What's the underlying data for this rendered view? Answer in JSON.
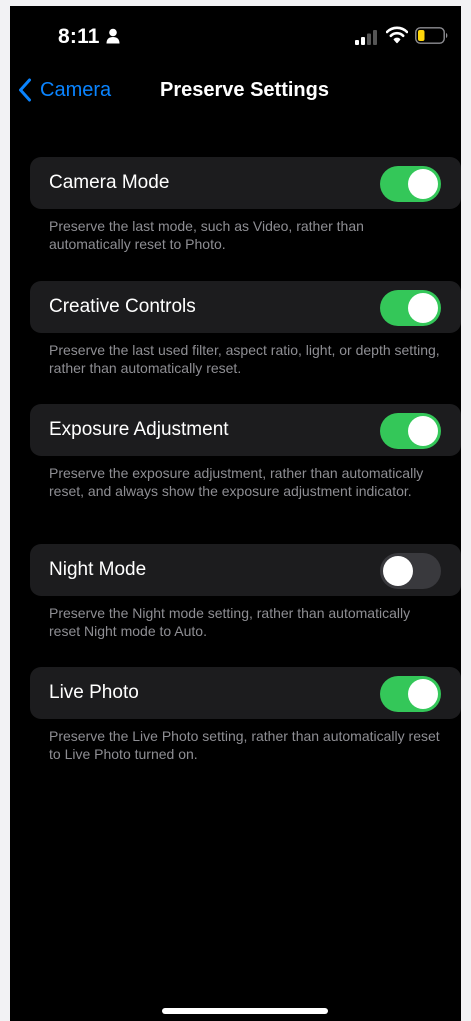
{
  "status_bar": {
    "time": "8:11",
    "icons": [
      "person-icon",
      "cellular-signal-icon",
      "wifi-icon",
      "battery-icon"
    ],
    "battery_color": "#ffd60a"
  },
  "nav": {
    "back_label": "Camera",
    "title": "Preserve Settings"
  },
  "colors": {
    "accent": "#0a84ff",
    "toggle_on": "#34c759",
    "toggle_off": "#39393d",
    "row_bg": "#1c1c1e",
    "footer_text": "#8e8e93"
  },
  "settings": [
    {
      "label": "Camera Mode",
      "enabled": true,
      "description": "Preserve the last mode, such as Video, rather than automatically reset to Photo."
    },
    {
      "label": "Creative Controls",
      "enabled": true,
      "description": "Preserve the last used filter, aspect ratio, light, or depth setting, rather than automatically reset."
    },
    {
      "label": "Exposure Adjustment",
      "enabled": true,
      "description": "Preserve the exposure adjustment, rather than automatically reset, and always show the exposure adjustment indicator."
    },
    {
      "label": "Night Mode",
      "enabled": false,
      "description": "Preserve the Night mode setting, rather than automatically reset Night mode to Auto."
    },
    {
      "label": "Live Photo",
      "enabled": true,
      "description": "Preserve the Live Photo setting, rather than automatically reset to Live Photo turned on."
    }
  ]
}
